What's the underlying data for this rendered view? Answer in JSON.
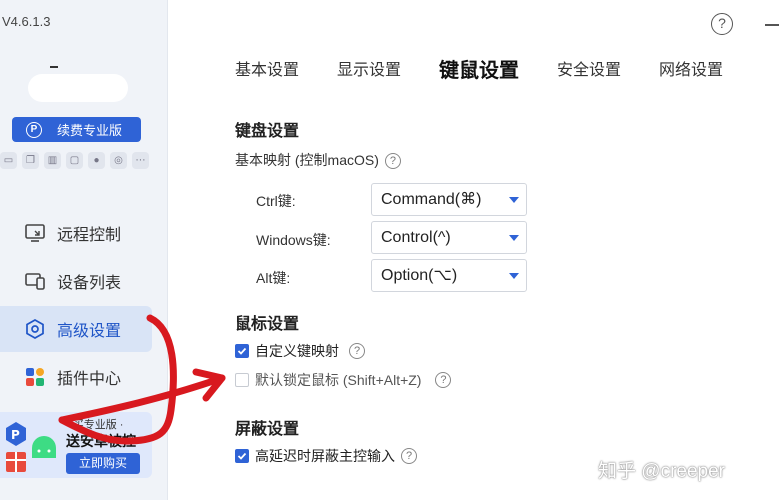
{
  "app": {
    "version": "V4.6.1.3"
  },
  "sidebar": {
    "renew_label": "续费专业版",
    "renew_icon": "p-badge-icon",
    "mini_icons": [
      "gamepad-icon",
      "copy-icon",
      "files-icon",
      "window-icon",
      "mic-icon",
      "camera-icon",
      "more-icon"
    ],
    "items": [
      {
        "label": "远程控制",
        "icon": "remote-control-icon"
      },
      {
        "label": "设备列表",
        "icon": "device-list-icon"
      },
      {
        "label": "高级设置",
        "icon": "hexagon-settings-icon",
        "active": true
      },
      {
        "label": "插件中心",
        "icon": "plugin-grid-icon"
      }
    ],
    "promo": {
      "subtitle": "· 买专业版 ·",
      "title": "送安卓被控",
      "button": "立即购买"
    }
  },
  "header": {
    "help": "?",
    "tabs": [
      "基本设置",
      "显示设置",
      "键鼠设置",
      "安全设置",
      "网络设置"
    ],
    "active_tab": "键鼠设置"
  },
  "keyboard": {
    "title": "键盘设置",
    "mapping_label": "基本映射 (控制macOS)",
    "rows": [
      {
        "label": "Ctrl键:",
        "value": "Command(⌘)"
      },
      {
        "label": "Windows键:",
        "value": "Control(^)"
      },
      {
        "label": "Alt键:",
        "value": "Option(⌥)"
      }
    ]
  },
  "mouse": {
    "title": "鼠标设置",
    "options": [
      {
        "label": "自定义键映射",
        "checked": true
      },
      {
        "label": "默认锁定鼠标 (Shift+Alt+Z)",
        "checked": false
      }
    ]
  },
  "shield": {
    "title": "屏蔽设置",
    "options": [
      {
        "label": "高延迟时屏蔽主控输入",
        "checked": true
      }
    ]
  },
  "watermark": "知乎 @creeper",
  "colors": {
    "accent": "#2f63d6",
    "active_bg": "#d9e4f6",
    "sidebar_bg": "#f0f3f8",
    "annotation": "#d8191f"
  }
}
